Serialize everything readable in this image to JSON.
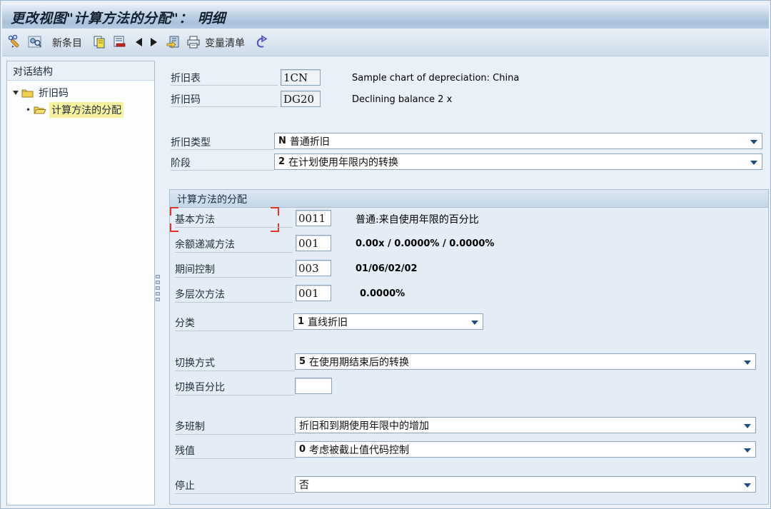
{
  "window": {
    "title": "更改视图\"计算方法的分配\"： 明细"
  },
  "toolbar": {
    "icons": [
      "display-change-icon",
      "overview-icon",
      "copy-entry-icon",
      "delete-entry-icon",
      "previous-entry-icon",
      "next-entry-icon",
      "other-entry-icon",
      "print-icon",
      "undo-icon"
    ],
    "new_entries_label": "新条目",
    "variable_list_label": "变量清单"
  },
  "sidebar": {
    "header": "对话结构",
    "items": [
      {
        "label": "折旧码",
        "level": 1,
        "state": "expanded",
        "selected": false
      },
      {
        "label": "计算方法的分配",
        "level": 2,
        "state": "leaf",
        "selected": true
      }
    ]
  },
  "fields": {
    "chart": {
      "label": "折旧表",
      "value": "1CN",
      "desc": "Sample chart of depreciation: China"
    },
    "key": {
      "label": "折旧码",
      "value": "DG20",
      "desc": "Declining balance 2 x"
    }
  },
  "type_row": {
    "label": "折旧类型",
    "key": "N",
    "text": "普通折旧"
  },
  "phase_row": {
    "label": "阶段",
    "key": "2",
    "text": "在计划使用年限内的转换"
  },
  "group": {
    "title": "计算方法的分配",
    "methods": [
      {
        "label": "基本方法",
        "value": "0011",
        "desc": "普通:来自使用年限的百分比"
      },
      {
        "label": "余额递减方法",
        "value": "001",
        "desc": "0.00x / 0.0000% / 0.0000%"
      },
      {
        "label": "期间控制",
        "value": "003",
        "desc": "01/06/02/02"
      },
      {
        "label": "多层次方法",
        "value": "001",
        "desc": "0.0000%"
      }
    ],
    "classification": {
      "label": "分类",
      "key": "1",
      "text": "直线折旧"
    },
    "changeover": {
      "label": "切换方式",
      "key": "5",
      "text": "在使用期结束后的转换"
    },
    "changeover_pct": {
      "label": "切换百分比",
      "value": ""
    },
    "multi_shift": {
      "label": "多班制",
      "key": "",
      "text": "折旧和到期使用年限中的增加"
    },
    "scrap_value": {
      "label": "残值",
      "key": "0",
      "text": "考虑被截止值代码控制"
    },
    "shutdown": {
      "label": "停止",
      "key": "",
      "text": "否"
    }
  },
  "colors": {
    "accent_title": "#10202f",
    "selection_yellow": "#f8f2a0",
    "focus_red": "#e3342c",
    "dropdown_arrow": "#1b4e7e",
    "folder_yellow": "#f2cf4e"
  }
}
